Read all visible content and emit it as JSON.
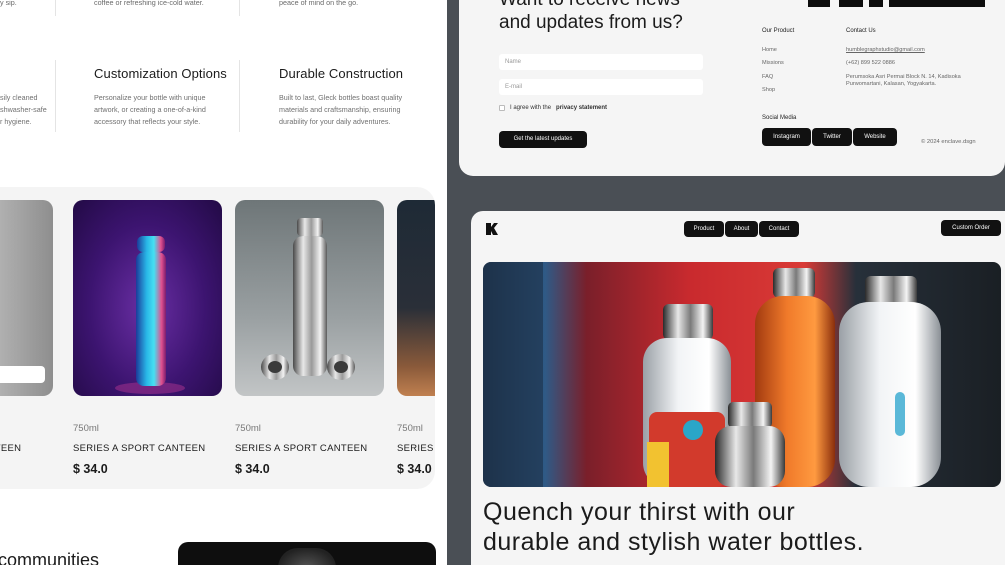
{
  "features_top": {
    "col1": "y sip.",
    "col2": "coffee or refreshing ice-cold water.",
    "col3": "peace of mind on the go."
  },
  "features": [
    {
      "title": "",
      "desc": [
        "sily cleaned",
        "shwasher-safe",
        "r hygiene."
      ]
    },
    {
      "title": "Customization Options",
      "desc": [
        "Personalize your bottle with unique",
        "artwork, or creating a one-of-a-kind",
        "accessory that reflects your style."
      ]
    },
    {
      "title": "Durable Construction",
      "desc": [
        "Built to last, Gleck bottles boast quality",
        "materials and craftsmanship, ensuring",
        "durability for your daily adventures."
      ]
    }
  ],
  "products": [
    {
      "size": "",
      "name": "ANTEEN",
      "price": "",
      "button": "t"
    },
    {
      "size": "750ml",
      "name": "SERIES A SPORT CANTEEN",
      "price": "$ 34.0"
    },
    {
      "size": "750ml",
      "name": "SERIES A SPORT CANTEEN",
      "price": "$ 34.0"
    },
    {
      "size": "750ml",
      "name": "SERIES A",
      "price": "$ 34.0"
    }
  ],
  "communities_text": "communities",
  "newsletter": {
    "headline_line1": "Want to receive news",
    "headline_line2": "and updates from us?",
    "name_placeholder": "Name",
    "email_placeholder": "E-mail",
    "agree_prefix": "I agree with the",
    "agree_link": "privacy statement",
    "submit_label": "Get the latest updates"
  },
  "footer": {
    "our_product_heading": "Our Product",
    "our_product_items": [
      "Home",
      "Missions",
      "FAQ",
      "Shop"
    ],
    "contact_heading": "Contact Us",
    "email": "humblegraphstudio@gmail.com",
    "phone": "(+62) 899 522 0886",
    "address_line1": "Perumsoka Asri Permai Block N. 14, Kadisoka",
    "address_line2": "Purwomartani, Kalasan, Yogyakarta.",
    "social_heading": "Social Media",
    "social_buttons": [
      "Instagram",
      "Twitter",
      "Website"
    ],
    "copyright": "© 2024 enclave.dsgn"
  },
  "hero_nav": {
    "items": [
      "Product",
      "About",
      "Contact"
    ],
    "custom_order": "Custom Order"
  },
  "hero_tagline_line1": "Quench your thirst with our",
  "hero_tagline_line2": "durable and stylish water bottles.",
  "colors": {
    "dark": "#111111",
    "panel": "#f5f5f5",
    "divider": "#4a4f55"
  }
}
